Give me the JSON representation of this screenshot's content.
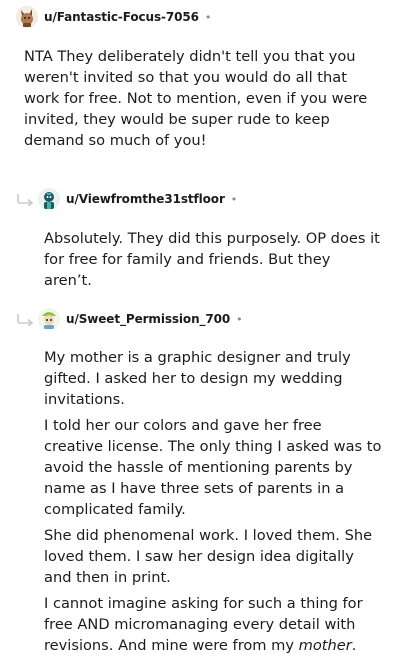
{
  "comments": [
    {
      "username": "u/Fantastic-Focus-7056",
      "separator": "•",
      "paragraphs": [
        "NTA They deliberately didn't tell you that you weren't invited so that you would do all that work for free. Not to mention, even if you were invited, they would be super rude to keep demand so much of you!"
      ]
    },
    {
      "username": "u/Viewfromthe31stfloor",
      "separator": "•",
      "paragraphs": [
        "Absolutely. They did this purposely. OP does it for free for family and friends. But they aren’t."
      ]
    },
    {
      "username": "u/Sweet_Permission_700",
      "separator": "•",
      "paragraphs": [
        "My mother is a graphic designer and truly gifted. I asked her to design my wedding invitations.",
        "I told her our colors and gave her free creative license. The only thing I asked was to avoid the hassle of mentioning parents by name as I have three sets of parents in a complicated family.",
        "She did phenomenal work. I loved them. She loved them. I saw her design idea digitally and then in print."
      ],
      "last_paragraph_prefix": "I cannot imagine asking for such a thing for free AND micromanaging every detail with revisions. And mine were from my ",
      "last_paragraph_emphasis": "mother",
      "last_paragraph_suffix": "."
    }
  ],
  "colors": {
    "text": "#1c1c1c",
    "meta": "#878a8c",
    "reply_arrow": "#c8cbcd"
  }
}
